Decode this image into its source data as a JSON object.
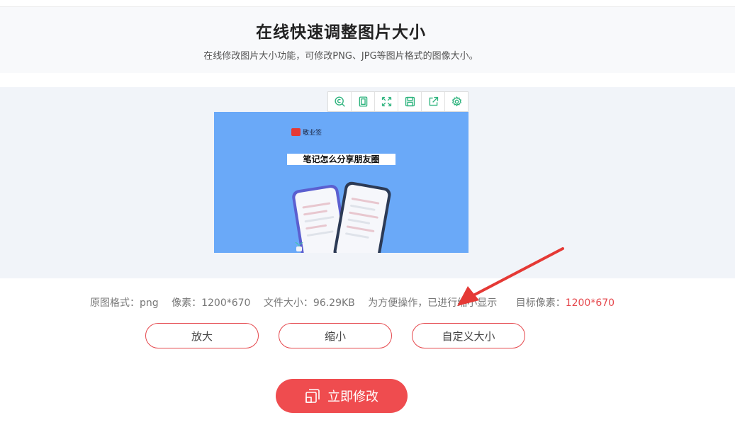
{
  "header": {
    "title": "在线快速调整图片大小",
    "subtitle": "在线修改图片大小功能，可修改PNG、JPG等图片格式的图像大小。"
  },
  "toolbar": {
    "icons": [
      "zoom-copyright-icon",
      "fit-page-icon",
      "expand-icon",
      "save-icon",
      "share-icon",
      "settings-icon"
    ],
    "accent": "#2db37d"
  },
  "preview": {
    "brand": "敬业签",
    "banner": "笔记怎么分享朋友圈",
    "background": "#6aa9f8"
  },
  "info": {
    "format": "原图格式：png",
    "pixels": "像素：1200*670",
    "filesize": "文件大小：96.29KB",
    "note": "为方便操作，已进行缩小显示",
    "target_label": "目标像素：",
    "target_value": "1200*670"
  },
  "buttons": {
    "zoom_in": "放大",
    "zoom_out": "缩小",
    "custom": "自定义大小",
    "submit": "立即修改"
  },
  "colors": {
    "brand_red": "#ef4c4f",
    "outline_red": "#e5484d",
    "arrow_red": "#e53935"
  }
}
